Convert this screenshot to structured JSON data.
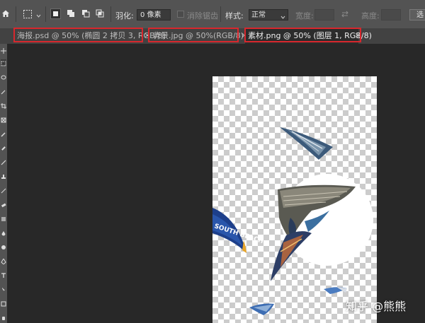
{
  "options_bar": {
    "feather_label": "羽化:",
    "feather_value": "0 像素",
    "antialias_label": "消除锯齿",
    "style_label": "样式:",
    "style_value": "正常",
    "width_label": "宽度:",
    "height_label": "高度:",
    "select_mask_label": "选"
  },
  "tabs": [
    {
      "label": "海报.psd @ 50% (椭圆 2 拷贝 3, RGB/8)",
      "close": "×",
      "active": false
    },
    {
      "label": "背景.jpg @ 50%(RGB/8)",
      "close": "×",
      "active": false
    },
    {
      "label": "素材.png @ 50% (图层 1, RGB/8)",
      "close": "×",
      "active": true
    }
  ],
  "canvas": {
    "artwork_text": "SOUTH BEACH"
  },
  "watermark": "知乎 @熊熊",
  "colors": {
    "highlight_box": "#d8272d",
    "app_bg": "#282828",
    "panel_bg": "#535353"
  }
}
